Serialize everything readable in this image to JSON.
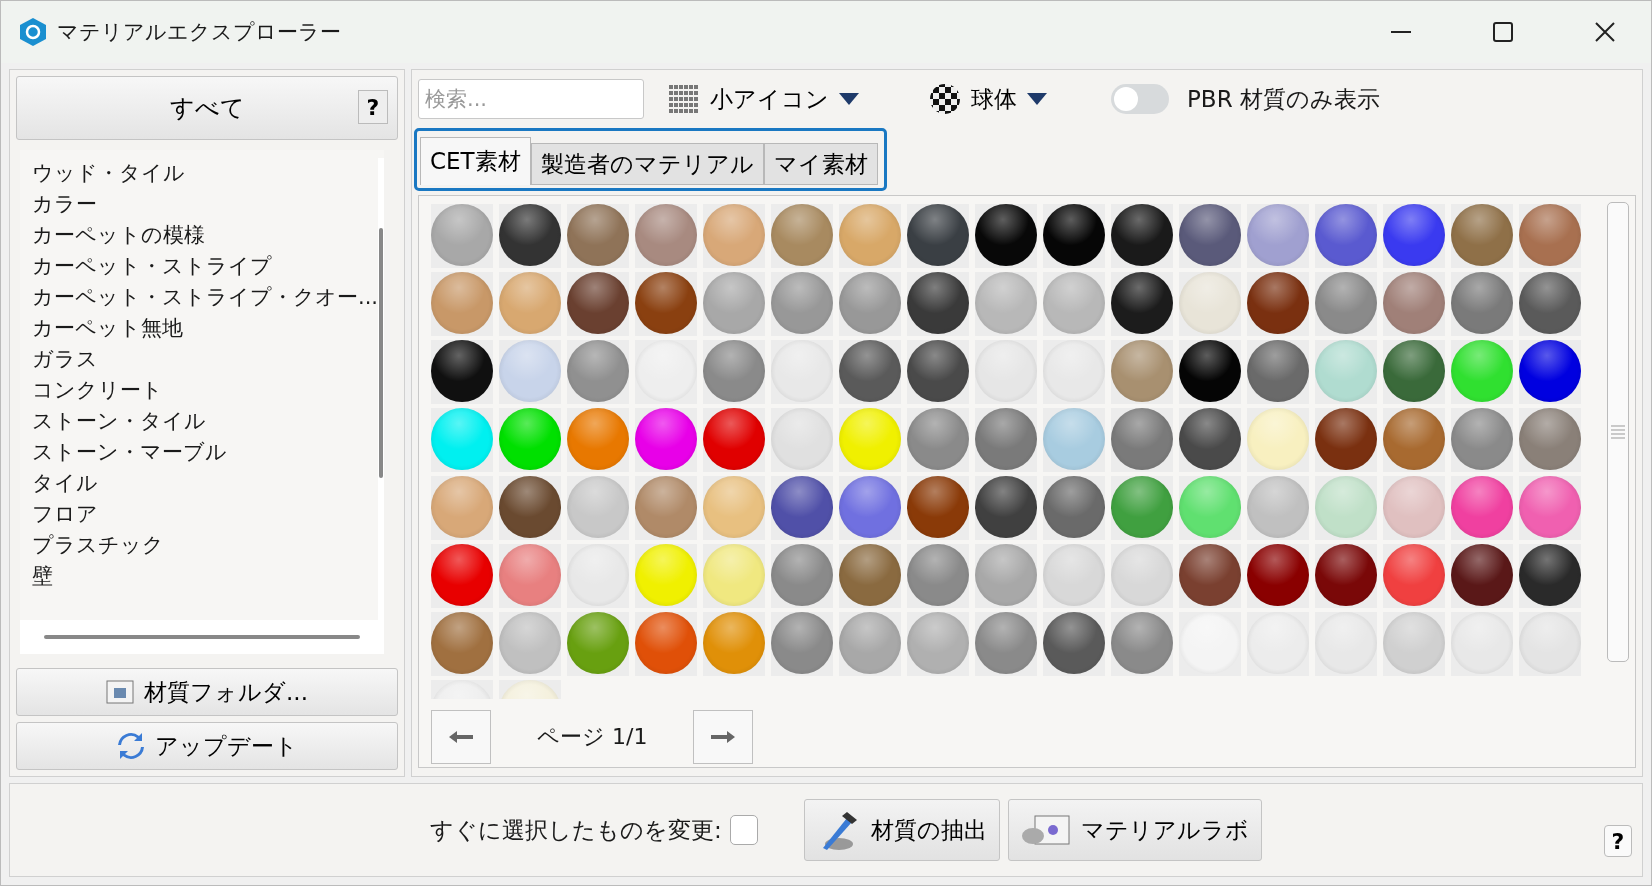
{
  "window": {
    "title": "マテリアルエクスプローラー"
  },
  "sidebar": {
    "all_button": "すべて",
    "help": "?",
    "categories": [
      "ウッド・タイル",
      "カラー",
      "カーペットの模様",
      "カーペット・ストライプ",
      "カーペット・ストライプ・クオー...",
      "カーペット無地",
      "ガラス",
      "コンクリート",
      "ストーン・タイル",
      "ストーン・マーブル",
      "タイル",
      "フロア",
      "プラスチック",
      "壁"
    ],
    "folder_button": "材質フォルダ...",
    "update_button": "アップデート"
  },
  "toolbar": {
    "search": {
      "placeholder": "検索..."
    },
    "view": "小アイコン",
    "shape": "球体",
    "pbr_toggle": {
      "label": "PBR 材質のみ表示",
      "on": false
    }
  },
  "tabs": [
    {
      "label": "CET素材",
      "selected": true
    },
    {
      "label": "製造者のマテリアル",
      "selected": false
    },
    {
      "label": "マイ素材",
      "selected": false
    }
  ],
  "materials": [
    [
      {
        "color": "#a8a8a8"
      },
      {
        "color": "#333333"
      },
      {
        "color": "#8f7358"
      },
      {
        "color": "#a88a80"
      },
      {
        "color": "#d8a878"
      },
      {
        "color": "#a88a60"
      },
      {
        "color": "#d8a868"
      },
      {
        "color": "#3a3f44"
      },
      {
        "color": "#080808"
      },
      {
        "color": "#060606"
      },
      {
        "color": "#1a1a1a"
      },
      {
        "color": "#5a5a7a"
      },
      {
        "color": "#a0a0d0"
      },
      {
        "color": "#5a5ad0"
      },
      {
        "color": "#3a3af0"
      },
      {
        "color": "#8f7048"
      },
      {
        "color": "#a87050"
      }
    ],
    [
      {
        "color": "#c89868"
      },
      {
        "color": "#d8a870"
      },
      {
        "color": "#6a4030"
      },
      {
        "color": "#8a4010"
      },
      {
        "color": "#a8a8a8"
      },
      {
        "color": "#989898"
      },
      {
        "color": "#989898"
      },
      {
        "color": "#3a3a3a"
      },
      {
        "color": "#b8b8b8"
      },
      {
        "color": "#b8b8b8"
      },
      {
        "color": "#1c1c1c"
      },
      {
        "color": "#e8e4d8"
      },
      {
        "color": "#7a3010"
      },
      {
        "color": "#8a8a8a"
      },
      {
        "color": "#a08078"
      },
      {
        "color": "#7a7a7a"
      },
      {
        "color": "#5a5a5a"
      }
    ],
    [
      {
        "color": "#101010"
      },
      {
        "color": "#c8d4ea"
      },
      {
        "color": "#909090"
      },
      {
        "color": "#eeeeee"
      },
      {
        "color": "#8a8a8a"
      },
      {
        "color": "#e8e8e8"
      },
      {
        "color": "#5a5a5a"
      },
      {
        "color": "#4a4a4a"
      },
      {
        "color": "#e6e6e6"
      },
      {
        "color": "#e8e8e8"
      },
      {
        "color": "#a89070"
      },
      {
        "color": "#050505"
      },
      {
        "color": "#6a6a6a"
      },
      {
        "color": "#b0dcd0"
      },
      {
        "color": "#3a6a3a"
      },
      {
        "color": "#30e030"
      },
      {
        "color": "#0000e0"
      }
    ],
    [
      {
        "color": "#00f0f0"
      },
      {
        "color": "#00e000"
      },
      {
        "color": "#e87800"
      },
      {
        "color": "#e800e8"
      },
      {
        "color": "#e00000"
      },
      {
        "color": "#e0e0e0"
      },
      {
        "color": "#f0f000"
      },
      {
        "color": "#8a8a8a"
      },
      {
        "color": "#7a7a7a"
      },
      {
        "color": "#a8cce0"
      },
      {
        "color": "#7a7a7a"
      },
      {
        "color": "#4a4a4a"
      },
      {
        "color": "#f8f0c0"
      },
      {
        "color": "#7a3010"
      },
      {
        "color": "#a86a30"
      },
      {
        "color": "#8a8a8a"
      },
      {
        "color": "#8a8078"
      }
    ],
    [
      {
        "color": "#d8a878"
      },
      {
        "color": "#6a4a30"
      },
      {
        "color": "#c8c8c8"
      },
      {
        "color": "#b08a68"
      },
      {
        "color": "#e8c080"
      },
      {
        "color": "#5050a8"
      },
      {
        "color": "#7070e0"
      },
      {
        "color": "#8a3a08"
      },
      {
        "color": "#404040"
      },
      {
        "color": "#6a6a6a"
      },
      {
        "color": "#40a040"
      },
      {
        "color": "#60e070"
      },
      {
        "color": "#c0c0c0"
      },
      {
        "color": "#c0e0c8"
      },
      {
        "color": "#e0c0c0"
      },
      {
        "color": "#f040a0"
      },
      {
        "color": "#f060b0"
      }
    ],
    [
      {
        "color": "#e80000"
      },
      {
        "color": "#e88080"
      },
      {
        "color": "#e8e8e8"
      },
      {
        "color": "#f0f000"
      },
      {
        "color": "#f0e880"
      },
      {
        "color": "#8a8a8a"
      },
      {
        "color": "#8a6a40"
      },
      {
        "color": "#8a8a8a"
      },
      {
        "color": "#a8a8a8"
      },
      {
        "color": "#d8d8d8"
      },
      {
        "color": "#d8d8d8"
      },
      {
        "color": "#7a4030"
      },
      {
        "color": "#8a0000"
      },
      {
        "color": "#7a0808"
      },
      {
        "color": "#f04040"
      },
      {
        "color": "#5a1818"
      },
      {
        "color": "#2a2a2a"
      }
    ],
    [
      {
        "color": "#a07040"
      },
      {
        "color": "#c0c0c0"
      },
      {
        "color": "#68a010"
      },
      {
        "color": "#e05008"
      },
      {
        "color": "#e09008"
      },
      {
        "color": "#8a8a8a"
      },
      {
        "color": "#a8a8a8"
      },
      {
        "color": "#b0b0b0"
      },
      {
        "color": "#8a8a8a"
      },
      {
        "color": "#5a5a5a"
      },
      {
        "color": "#8a8a8a"
      },
      {
        "color": "#f4f4f4"
      },
      {
        "color": "#ececec"
      },
      {
        "color": "#e8e8e8"
      },
      {
        "color": "#d0d0d0"
      },
      {
        "color": "#e8e8e8"
      },
      {
        "color": "#e4e4e4"
      }
    ],
    [
      {
        "color": "#eeeeee"
      },
      {
        "color": "#f4f0dc"
      }
    ]
  ],
  "pager": {
    "label": "ページ 1/1"
  },
  "footer": {
    "instant_change": {
      "label": "すぐに選択したものを変更:",
      "checked": false
    },
    "extract_button": "材質の抽出",
    "lab_button": "マテリアルラボ",
    "help": "?"
  }
}
